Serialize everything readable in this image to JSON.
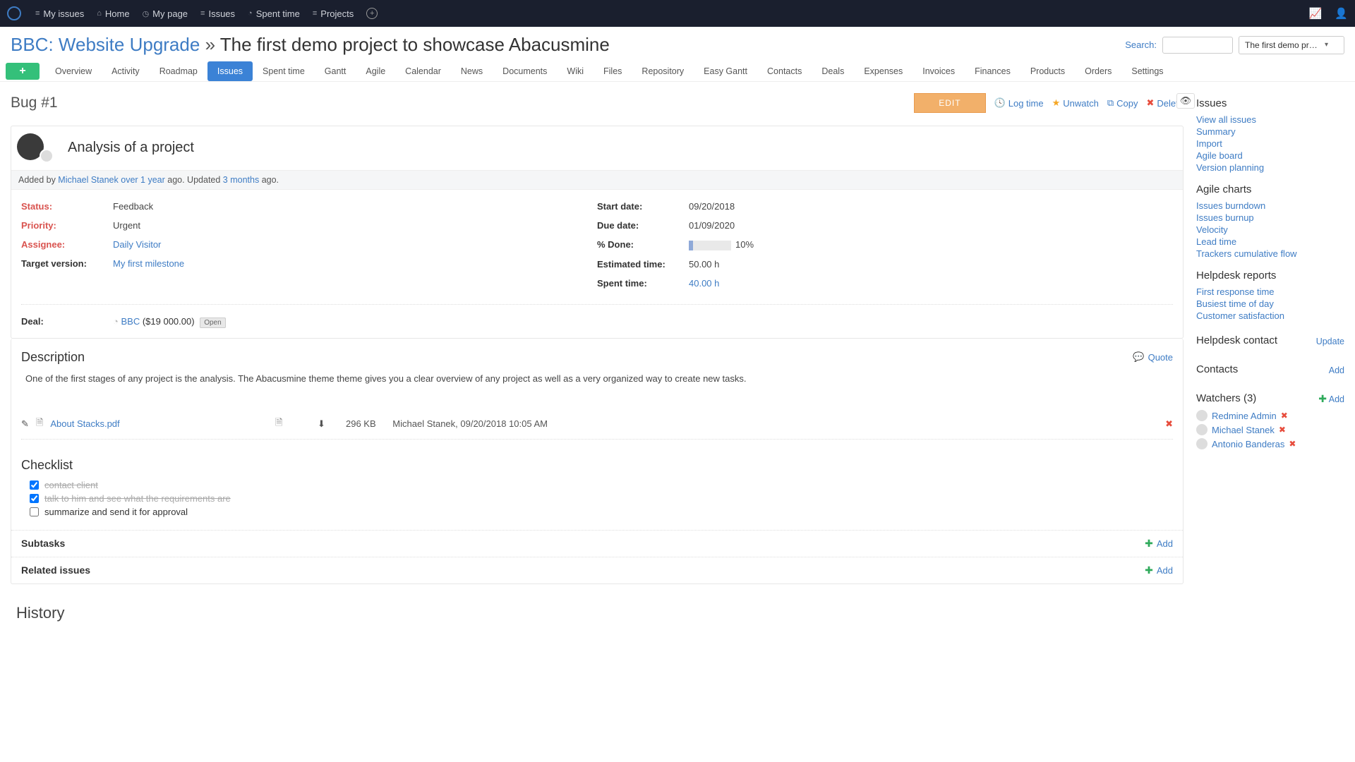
{
  "topnav": {
    "items": [
      {
        "icon": "≡",
        "label": "My issues"
      },
      {
        "icon": "⌂",
        "label": "Home"
      },
      {
        "icon": "◷",
        "label": "My page"
      },
      {
        "icon": "≡",
        "label": "Issues"
      },
      {
        "icon": "◔",
        "label": "Spent time"
      },
      {
        "icon": "≡",
        "label": "Projects"
      }
    ]
  },
  "header": {
    "project": "BBC: Website Upgrade",
    "separator": "»",
    "subtitle": "The first demo project to showcase Abacusmine",
    "search_label": "Search:",
    "project_select": "The first demo project to ..."
  },
  "tabs": [
    "Overview",
    "Activity",
    "Roadmap",
    "Issues",
    "Spent time",
    "Gantt",
    "Agile",
    "Calendar",
    "News",
    "Documents",
    "Wiki",
    "Files",
    "Repository",
    "Easy Gantt",
    "Contacts",
    "Deals",
    "Expenses",
    "Invoices",
    "Finances",
    "Products",
    "Orders",
    "Settings"
  ],
  "active_tab": "Issues",
  "issue": {
    "id": "Bug #1",
    "title": "Analysis of a project",
    "actions": {
      "edit": "EDIT",
      "logtime": "Log time",
      "unwatch": "Unwatch",
      "copy": "Copy",
      "delete": "Delete"
    },
    "meta": {
      "added_by_prefix": "Added by ",
      "author": "Michael Stanek",
      "over": " over 1 year",
      "ago1": " ago. Updated ",
      "updated": "3 months",
      "ago2": " ago."
    },
    "details_left": [
      {
        "label": "Status:",
        "value": "Feedback",
        "red": true,
        "link": false
      },
      {
        "label": "Priority:",
        "value": "Urgent",
        "red": true,
        "link": false
      },
      {
        "label": "Assignee:",
        "value": "Daily Visitor",
        "red": true,
        "link": true
      },
      {
        "label": "Target version:",
        "value": "My first milestone",
        "red": false,
        "link": true
      }
    ],
    "details_right": [
      {
        "label": "Start date:",
        "value": "09/20/2018"
      },
      {
        "label": "Due date:",
        "value": "01/09/2020"
      },
      {
        "label": "% Done:",
        "value": "10%",
        "progress": true
      },
      {
        "label": "Estimated time:",
        "value": "50.00 h"
      },
      {
        "label": "Spent time:",
        "value": "40.00 h",
        "link": true
      }
    ],
    "deal": {
      "label": "Deal:",
      "name": "BBC",
      "amount": "($19 000.00)",
      "status": "Open"
    },
    "description_h": "Description",
    "quote": "Quote",
    "description": "One of the first stages of any project is the analysis. The Abacusmine theme theme gives you a clear overview of any project as well as a very organized way to create new tasks.",
    "attachment": {
      "name": "About Stacks.pdf",
      "size": "296 KB",
      "meta": "Michael Stanek, 09/20/2018 10:05 AM"
    },
    "checklist_h": "Checklist",
    "checklist": [
      {
        "done": true,
        "text": "contact client"
      },
      {
        "done": true,
        "text": "talk to him and see what the requirements are"
      },
      {
        "done": false,
        "text": "summarize and send it for approval"
      }
    ],
    "subtasks": "Subtasks",
    "related": "Related issues",
    "add": "Add",
    "history": "History"
  },
  "sidebar": {
    "issues_h": "Issues",
    "issues_links": [
      "View all issues",
      "Summary",
      "Import",
      "Agile board",
      "Version planning"
    ],
    "agile_h": "Agile charts",
    "agile_links": [
      "Issues burndown",
      "Issues burnup",
      "Velocity",
      "Lead time",
      "Trackers cumulative flow"
    ],
    "helpdesk_h": "Helpdesk reports",
    "helpdesk_links": [
      "First response time",
      "Busiest time of day",
      "Customer satisfaction"
    ],
    "helpdesk_contact": "Helpdesk contact",
    "update": "Update",
    "contacts_h": "Contacts",
    "add": "Add",
    "watchers_h": "Watchers (3)",
    "watchers": [
      "Redmine Admin",
      "Michael Stanek",
      "Antonio Banderas"
    ]
  }
}
